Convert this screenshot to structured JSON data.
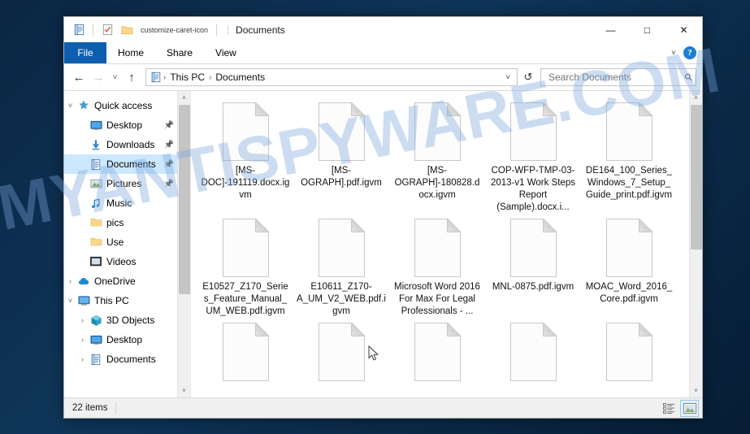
{
  "watermark": {
    "text": "MYANTISPYWARE.COM"
  },
  "window": {
    "title": "Documents",
    "quick_access_icons": [
      "properties-icon",
      "new-folder-icon",
      "customize-caret-icon"
    ],
    "controls": {
      "minimize": "—",
      "maximize": "□",
      "close": "✕"
    }
  },
  "ribbon": {
    "tabs": [
      {
        "label": "File",
        "active": true
      },
      {
        "label": "Home",
        "active": false
      },
      {
        "label": "Share",
        "active": false
      },
      {
        "label": "View",
        "active": false
      }
    ],
    "expand_caret": "˅",
    "help_label": "?"
  },
  "address": {
    "back": "←",
    "forward": "→",
    "recent": "˅",
    "up": "↑",
    "breadcrumbs": [
      "This PC",
      "Documents"
    ],
    "separator": "›",
    "dropdown_caret": "˅",
    "refresh": "↺"
  },
  "search": {
    "placeholder": "Search Documents",
    "value": ""
  },
  "sidebar": {
    "items": [
      {
        "label": "Quick access",
        "icon": "star-pin-icon",
        "expander": "˅",
        "level": 0,
        "selected": false,
        "pinned": false
      },
      {
        "label": "Desktop",
        "icon": "desktop-icon",
        "expander": "",
        "level": 1,
        "selected": false,
        "pinned": true
      },
      {
        "label": "Downloads",
        "icon": "downloads-icon",
        "expander": "",
        "level": 1,
        "selected": false,
        "pinned": true
      },
      {
        "label": "Documents",
        "icon": "documents-icon",
        "expander": "",
        "level": 1,
        "selected": true,
        "pinned": true
      },
      {
        "label": "Pictures",
        "icon": "pictures-icon",
        "expander": "",
        "level": 1,
        "selected": false,
        "pinned": true
      },
      {
        "label": "Music",
        "icon": "music-icon",
        "expander": "",
        "level": 1,
        "selected": false,
        "pinned": false
      },
      {
        "label": "pics",
        "icon": "folder-icon",
        "expander": "",
        "level": 1,
        "selected": false,
        "pinned": false
      },
      {
        "label": "Use",
        "icon": "folder-icon",
        "expander": "",
        "level": 1,
        "selected": false,
        "pinned": false
      },
      {
        "label": "Videos",
        "icon": "videos-icon",
        "expander": "",
        "level": 1,
        "selected": false,
        "pinned": false
      },
      {
        "label": "OneDrive",
        "icon": "onedrive-cloud-icon",
        "expander": "›",
        "level": 0,
        "selected": false,
        "pinned": false
      },
      {
        "label": "This PC",
        "icon": "this-pc-icon",
        "expander": "˅",
        "level": 0,
        "selected": false,
        "pinned": false
      },
      {
        "label": "3D Objects",
        "icon": "3d-objects-icon",
        "expander": "›",
        "level": 1,
        "selected": false,
        "pinned": false
      },
      {
        "label": "Desktop",
        "icon": "desktop-icon",
        "expander": "›",
        "level": 1,
        "selected": false,
        "pinned": false
      },
      {
        "label": "Documents",
        "icon": "documents-icon",
        "expander": "›",
        "level": 1,
        "selected": false,
        "pinned": false
      }
    ],
    "scroll": {
      "up_arrow": "˄",
      "down_arrow": "˅",
      "thumb_top_pct": 0,
      "thumb_height_pct": 68
    }
  },
  "files": {
    "items": [
      {
        "name": "[MS-DOC]-191119.docx.igvm",
        "icon": "generic-file-icon"
      },
      {
        "name": "[MS-OGRAPH].pdf.igvm",
        "icon": "generic-file-icon"
      },
      {
        "name": "[MS-OGRAPH]-180828.docx.igvm",
        "icon": "generic-file-icon"
      },
      {
        "name": "COP-WFP-TMP-03-2013-v1 Work Steps Report (Sample).docx.i...",
        "icon": "generic-file-icon"
      },
      {
        "name": "DE164_100_Series_Windows_7_Setup_Guide_print.pdf.igvm",
        "icon": "generic-file-icon"
      },
      {
        "name": "E10527_Z170_Series_Feature_Manual_UM_WEB.pdf.igvm",
        "icon": "generic-file-icon"
      },
      {
        "name": "E10611_Z170-A_UM_V2_WEB.pdf.igvm",
        "icon": "generic-file-icon"
      },
      {
        "name": "Microsoft Word 2016 For Max For Legal Professionals - ...",
        "icon": "generic-file-icon"
      },
      {
        "name": "MNL-0875.pdf.igvm",
        "icon": "generic-file-icon"
      },
      {
        "name": "MOAC_Word_2016_Core.pdf.igvm",
        "icon": "generic-file-icon"
      },
      {
        "name": "",
        "icon": "generic-file-icon"
      },
      {
        "name": "",
        "icon": "generic-file-icon"
      },
      {
        "name": "",
        "icon": "generic-file-icon"
      },
      {
        "name": "",
        "icon": "generic-file-icon"
      },
      {
        "name": "",
        "icon": "generic-file-icon"
      }
    ],
    "scroll": {
      "up_arrow": "˄",
      "down_arrow": "˅",
      "thumb_top_pct": 0,
      "thumb_height_pct": 52
    }
  },
  "status": {
    "item_count": "22 items",
    "views": [
      {
        "name": "details-view",
        "active": false
      },
      {
        "name": "large-icons-view",
        "active": true
      }
    ]
  }
}
